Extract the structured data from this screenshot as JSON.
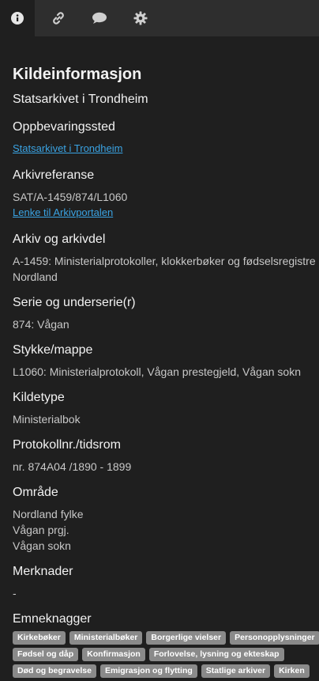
{
  "tabs": [
    {
      "name": "info-icon"
    },
    {
      "name": "link-icon"
    },
    {
      "name": "comment-icon"
    },
    {
      "name": "gear-icon"
    }
  ],
  "title": "Kildeinformasjon",
  "subtitle": "Statsarkivet i Trondheim",
  "sections": {
    "storage": {
      "heading": "Oppbevaringssted",
      "link": "Statsarkivet i Trondheim"
    },
    "reference": {
      "heading": "Arkivreferanse",
      "value": "SAT/A-1459/874/L1060",
      "link": "Lenke til Arkivportalen"
    },
    "archive": {
      "heading": "Arkiv og arkivdel",
      "line1": "A-1459: Ministerialprotokoller, klokkerbøker og fødselsregistre",
      "line2": "Nordland"
    },
    "series": {
      "heading": "Serie og underserie(r)",
      "value": "874: Vågan"
    },
    "piece": {
      "heading": "Stykke/mappe",
      "value": "L1060: Ministerialprotokoll, Vågan prestegjeld, Vågan sokn"
    },
    "source_type": {
      "heading": "Kildetype",
      "value": "Ministerialbok"
    },
    "protocol": {
      "heading": "Protokollnr./tidsrom",
      "value": "nr. 874A04 /1890 - 1899"
    },
    "area": {
      "heading": "Område",
      "line1": "Nordland fylke",
      "line2": "Vågan prgj.",
      "line3": "Vågan sokn"
    },
    "notes": {
      "heading": "Merknader",
      "value": "-"
    },
    "tags_heading": "Emneknagger"
  },
  "tags": {
    "row1": [
      "Kirkebøker",
      "Ministerialbøker",
      "Borgerlige vielser",
      "Personopplysninger"
    ],
    "row2": [
      "Fødsel og dåp",
      "Konfirmasjon",
      "Forlovelse, lysning og ekteskap"
    ],
    "row3": [
      "Død og begravelse",
      "Emigrasjon og flytting",
      "Statlige arkiver",
      "Kirken"
    ]
  },
  "colors": {
    "background": "#1f1f1f",
    "tabbar": "#2e2e2e",
    "link": "#3aa3e3",
    "tag": "#8a8a8a"
  }
}
